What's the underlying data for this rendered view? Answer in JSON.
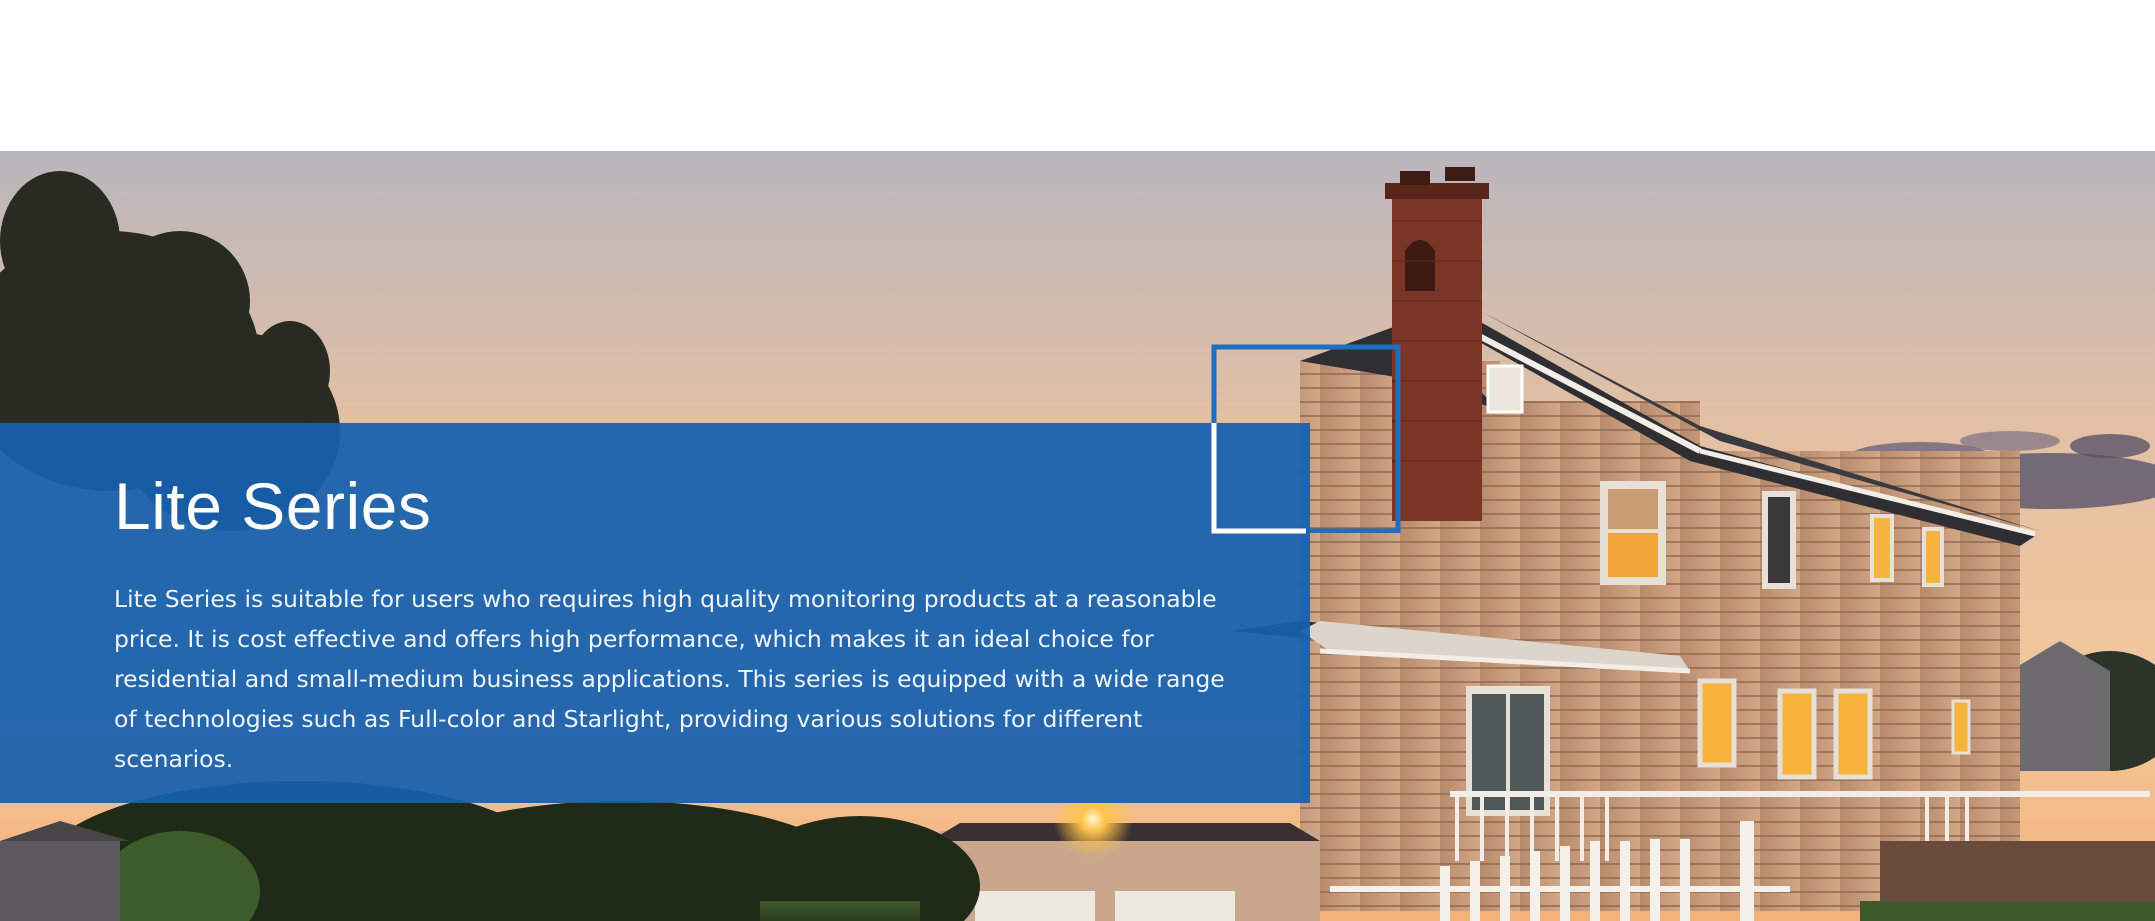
{
  "hero": {
    "title": "Lite Series",
    "description": "Lite Series is suitable for users who requires high quality monitoring products at a reasonable price. It is cost effective and offers high performance, which makes it an ideal choice for residential and small-medium business applications. This series is equipped with a wide range of technologies such as Full-color and Starlight, providing various solutions for different scenarios."
  },
  "colors": {
    "panel_blue": "#1560ae",
    "frame_blue": "#1c6fc2",
    "frame_white": "#ffffff",
    "sky_top": "#b9b6bd",
    "sky_bottom": "#f2c79b",
    "siding": "#c49a7c",
    "roof": "#2f2f33",
    "brick": "#7a3526",
    "window_glow": "#f6b43c"
  },
  "decoration": {
    "frame_icon": "corner-frame-icon"
  }
}
